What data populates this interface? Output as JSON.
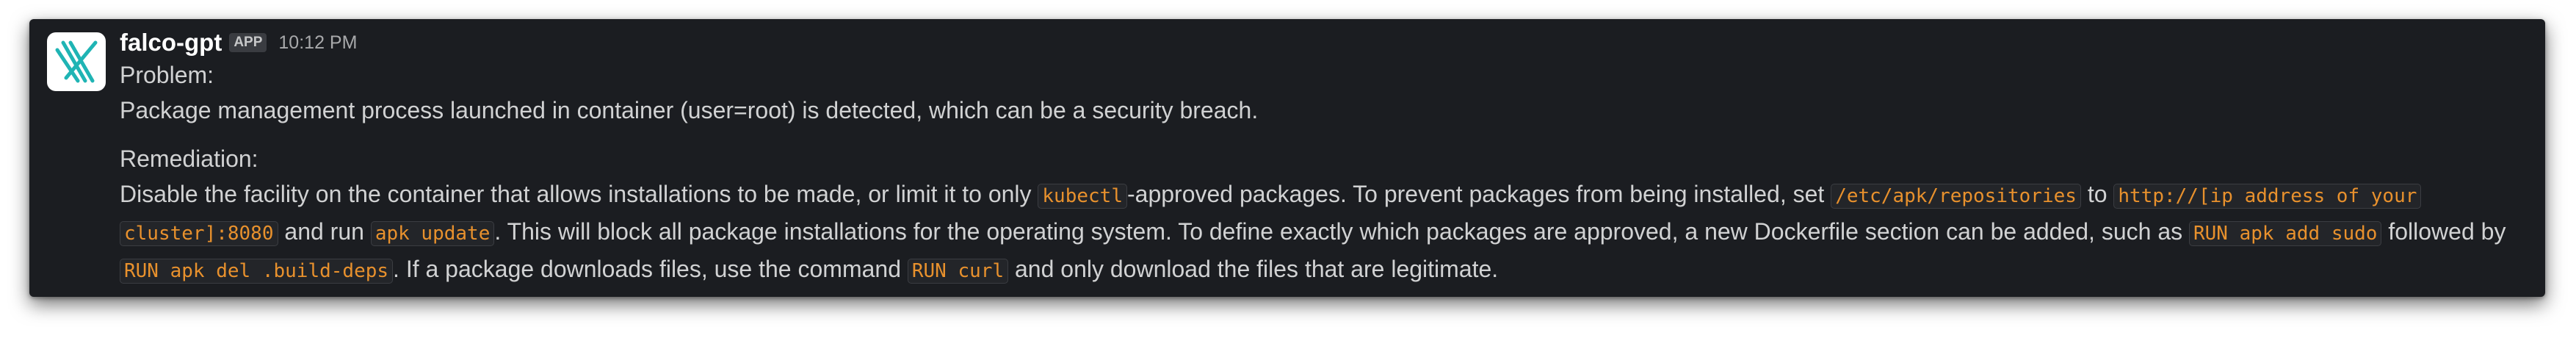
{
  "message": {
    "sender": "falco-gpt",
    "badge": "APP",
    "time": "10:12 PM",
    "problem_label": "Problem:",
    "problem_text": "Package management process launched in container (user=root) is detected, which can be a security breach.",
    "remediation_label": "Remediation:",
    "remediation": {
      "t1": "Disable the facility on the container that allows installations to be made, or limit it to only ",
      "c1": "kubectl",
      "t2": "-approved packages. To prevent packages from being installed, set ",
      "c2": "/etc/apk/repositories",
      "t3": " to ",
      "c3a": "http://[ip address of your",
      "c3b": "cluster]:8080",
      "t4": " and run ",
      "c4": "apk update",
      "t5": ". This will block all package installations for the operating system. To define exactly which packages are approved, a new Dockerfile section can be added, such as ",
      "c5": "RUN apk add sudo",
      "t6": " followed by",
      "c6": "RUN apk del .build-deps",
      "t7": ". If a package downloads files, use the command ",
      "c7": "RUN curl",
      "t8": " and only download the files that are legitimate."
    }
  },
  "colors": {
    "background": "#1b1d21",
    "text": "#d1d2d3",
    "code_text": "#e8912d",
    "avatar_logo": "#1fb4b4"
  },
  "icons": {
    "avatar": "falco-logo-icon"
  }
}
